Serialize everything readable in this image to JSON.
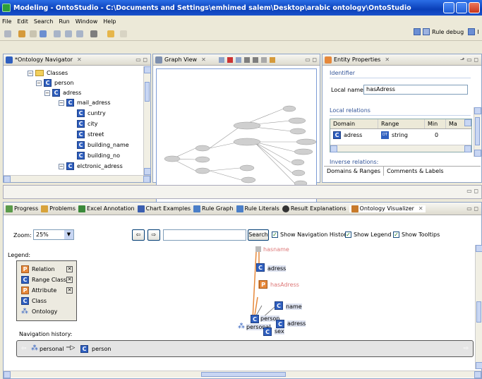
{
  "window": {
    "title": "Modeling - OntoStudio - C:\\Documents and Settings\\emhimed salem\\Desktop\\arabic ontology\\OntoStudio"
  },
  "menu": [
    "File",
    "Edit",
    "Search",
    "Run",
    "Window",
    "Help"
  ],
  "toolbar": {
    "perspective_label": "Rule debug",
    "perspective_label_cut": "I"
  },
  "navigator": {
    "tab_label": "*Ontology Navigator",
    "tree": [
      {
        "label": "Classes",
        "kind": "folder",
        "depth": 0
      },
      {
        "label": "person",
        "kind": "class",
        "depth": 1
      },
      {
        "label": "adress",
        "kind": "class",
        "depth": 2
      },
      {
        "label": "mail_adress",
        "kind": "class",
        "depth": 3
      },
      {
        "label": "cuntry",
        "kind": "class",
        "depth": 4
      },
      {
        "label": "city",
        "kind": "class",
        "depth": 4
      },
      {
        "label": "street",
        "kind": "class",
        "depth": 4
      },
      {
        "label": "building_name",
        "kind": "class",
        "depth": 4
      },
      {
        "label": "building_no",
        "kind": "class",
        "depth": 4
      },
      {
        "label": "elctronic_adress",
        "kind": "class",
        "depth": 3
      }
    ]
  },
  "graph_view": {
    "tab_label": "Graph View"
  },
  "entity_properties": {
    "tab_label": "Entity Properties",
    "identifier_heading": "Identifier",
    "local_name_label": "Local name:",
    "local_name_value": "hasAdress",
    "local_relations_heading": "Local relations",
    "columns": [
      "Domain",
      "Range",
      "Min",
      "Ma"
    ],
    "rows": [
      {
        "domain": "adress",
        "range_badge": "DT",
        "range": "string",
        "min": "0"
      }
    ],
    "inverse_heading": "Inverse relations:",
    "tabs": [
      "Domains & Ranges",
      "Comments & Labels"
    ]
  },
  "bottom_tabs": [
    {
      "label": "Progress",
      "color": "#5a9b4a"
    },
    {
      "label": "Problems",
      "color": "#d8a33a"
    },
    {
      "label": "Excel Annotation",
      "color": "#3b8a3b"
    },
    {
      "label": "Chart Examples",
      "color": "#3b5fb0"
    },
    {
      "label": "Rule Graph",
      "color": "#4b7fc8"
    },
    {
      "label": "Rule Literals",
      "color": "#4b7fc8"
    },
    {
      "label": "Result Explanations",
      "color": "#333333"
    },
    {
      "label": "Ontology Visualizer",
      "color": "#c87a2a"
    }
  ],
  "visualizer": {
    "zoom_label": "Zoom:",
    "zoom_value": "25%",
    "search_button": "Search",
    "search_value": "",
    "options": [
      {
        "label": "Show Navigation History",
        "checked": true
      },
      {
        "label": "Show Legend",
        "checked": true
      },
      {
        "label": "Show Tooltips",
        "checked": true
      }
    ],
    "legend_title": "Legend:",
    "legend": [
      {
        "badge": "P",
        "label": "Relation",
        "color": "#e6883a",
        "checkbox": true
      },
      {
        "badge": "C",
        "label": "Range Class",
        "color": "#2f5fbf",
        "checkbox": true
      },
      {
        "badge": "P",
        "label": "Attribute",
        "color": "#e6883a",
        "checkbox": true
      },
      {
        "badge": "C",
        "label": "Class",
        "color": "#2f5fbf",
        "checkbox": false
      },
      {
        "badge": "",
        "label": "Ontology",
        "color": "#2f5fbf",
        "checkbox": false
      }
    ],
    "nodes": {
      "hasname": "hasname",
      "adress1": "adress",
      "hasAdress": "hasAdress",
      "name": "name",
      "person": "person",
      "personal": "personal",
      "adress2": "adress",
      "sex": "sex"
    },
    "nav_history_label": "Navigation history:",
    "nav_history": [
      "personal",
      "person"
    ]
  }
}
